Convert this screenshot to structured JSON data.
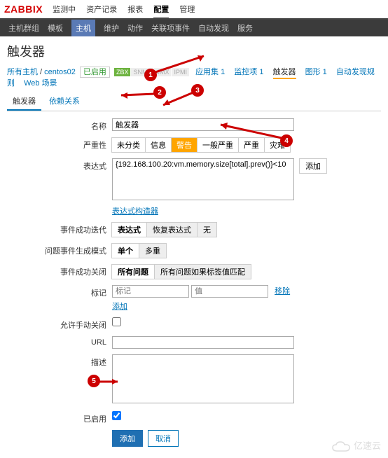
{
  "logo": "ZABBIX",
  "nav1": [
    "监测中",
    "资产记录",
    "报表",
    "配置",
    "管理"
  ],
  "nav1_active": 3,
  "nav2": [
    "主机群组",
    "模板",
    "主机",
    "维护",
    "动作",
    "关联项事件",
    "自动发现",
    "服务"
  ],
  "nav2_active": 2,
  "page_title": "触发器",
  "bc_all_hosts": "所有主机",
  "bc_host": "centos02",
  "enabled": "已启用",
  "badge_zbx": "ZBX",
  "badge_snmp": "SNMP",
  "badge_jmx": "JMX",
  "badge_ipmi": "IPMI",
  "links": [
    "应用集 1",
    "监控项 1",
    "触发器",
    "图形 1",
    "自动发现规则",
    "Web 场景"
  ],
  "links_sel": 2,
  "tabs": {
    "trigger": "触发器",
    "deps": "依赖关系"
  },
  "form": {
    "name_label": "名称",
    "name_value": "触发器",
    "sev_label": "严重性",
    "sev_opts": [
      "未分类",
      "信息",
      "警告",
      "一般严重",
      "严重",
      "灾难"
    ],
    "sev_sel": 2,
    "expr_label": "表达式",
    "expr_value": "{192.168.100.20:vm.memory.size[total].prev()}<10",
    "add_btn": "添加",
    "expr_builder": "表达式构造器",
    "ok_iter_label": "事件成功迭代",
    "ok_iter_opts": [
      "表达式",
      "恢复表达式",
      "无"
    ],
    "ok_iter_sel": 0,
    "gen_mode_label": "问题事件生成模式",
    "gen_mode_opts": [
      "单个",
      "多重"
    ],
    "gen_mode_sel": 0,
    "ok_close_label": "事件成功关闭",
    "ok_close_opts": [
      "所有问题",
      "所有问题如果标签值匹配"
    ],
    "ok_close_sel": 0,
    "tags_label": "标记",
    "tag_name_ph": "标记",
    "tag_val_ph": "值",
    "remove": "移除",
    "add_link": "添加",
    "manual_close_label": "允许手动关闭",
    "url_label": "URL",
    "desc_label": "描述",
    "enabled_label": "已启用",
    "submit": "添加",
    "cancel": "取消"
  },
  "markers": [
    "1",
    "2",
    "3",
    "4",
    "5"
  ],
  "watermark": "亿速云"
}
